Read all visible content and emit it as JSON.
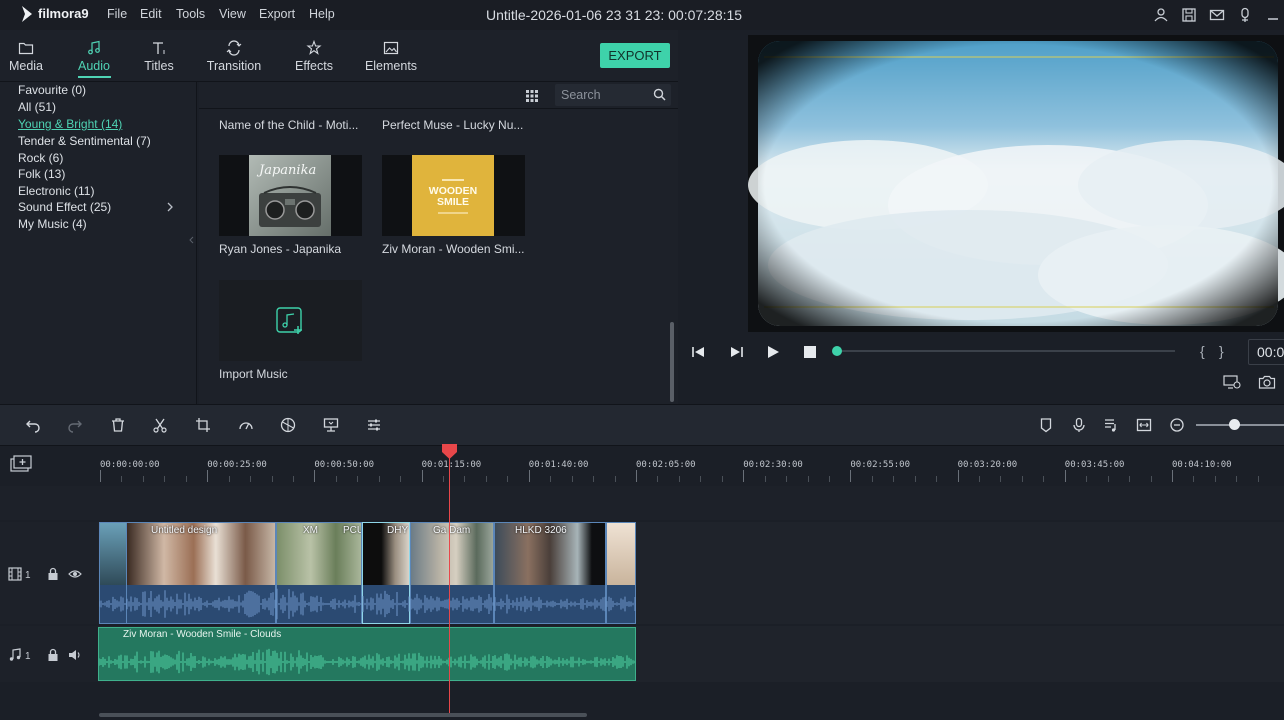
{
  "app": {
    "logo_text": "filmora9",
    "title": "Untitle-2026-01-06 23 31 23:  00:07:28:15"
  },
  "menu": [
    "File",
    "Edit",
    "Tools",
    "View",
    "Export",
    "Help"
  ],
  "titlebar_icons": [
    "account-icon",
    "save-icon",
    "mail-icon",
    "download-icon",
    "minimize-icon"
  ],
  "tabs": [
    {
      "label": "Media",
      "icon": "folder-icon",
      "active": false
    },
    {
      "label": "Audio",
      "icon": "music-note-icon",
      "active": true
    },
    {
      "label": "Titles",
      "icon": "text-icon",
      "active": false
    },
    {
      "label": "Transition",
      "icon": "transition-icon",
      "active": false
    },
    {
      "label": "Effects",
      "icon": "effects-icon",
      "active": false
    },
    {
      "label": "Elements",
      "icon": "image-icon",
      "active": false
    }
  ],
  "export_label": "EXPORT",
  "categories": [
    {
      "label": "Favourite (0)",
      "selected": false
    },
    {
      "label": "All (51)",
      "selected": false
    },
    {
      "label": "Young & Bright (14)",
      "selected": true
    },
    {
      "label": "Tender & Sentimental (7)",
      "selected": false
    },
    {
      "label": "Rock (6)",
      "selected": false
    },
    {
      "label": "Folk (13)",
      "selected": false
    },
    {
      "label": "Electronic (11)",
      "selected": false
    },
    {
      "label": "Sound Effect (25)",
      "selected": false
    },
    {
      "label": "My Music (4)",
      "selected": false
    }
  ],
  "search": {
    "placeholder": "Search"
  },
  "media_items": {
    "top_row": [
      "Name of the Child - Moti...",
      "Perfect Muse - Lucky Nu..."
    ],
    "item1": {
      "label": "Ryan Jones - Japanika",
      "thumb_text": "Japanika"
    },
    "item2": {
      "label": "Ziv Moran - Wooden Smi...",
      "thumb_text_1": "WOODEN",
      "thumb_text_2": "SMILE"
    },
    "import": {
      "label": "Import Music"
    }
  },
  "preview": {
    "timecode": "00:0",
    "brace_left": "{",
    "brace_right": "}"
  },
  "ruler": [
    "00:00:00:00",
    "00:00:25:00",
    "00:00:50:00",
    "00:01:15:00",
    "00:01:40:00",
    "00:02:05:00",
    "00:02:30:00",
    "00:02:55:00",
    "00:03:20:00",
    "00:03:45:00",
    "00:04:10:00"
  ],
  "tracks": {
    "video_num": "1",
    "audio_num": "1"
  },
  "video_clips": [
    "Untitled design",
    "XM",
    "PCU",
    "DHY",
    "Ga Dam",
    "HLKD 3206"
  ],
  "audio_clip": {
    "label": "Ziv Moran - Wooden Smile - Clouds"
  },
  "colors": {
    "accent": "#3ed2aa",
    "playhead": "#e8474a",
    "video_clip": "#2b4a72",
    "audio_clip": "#24785f"
  }
}
